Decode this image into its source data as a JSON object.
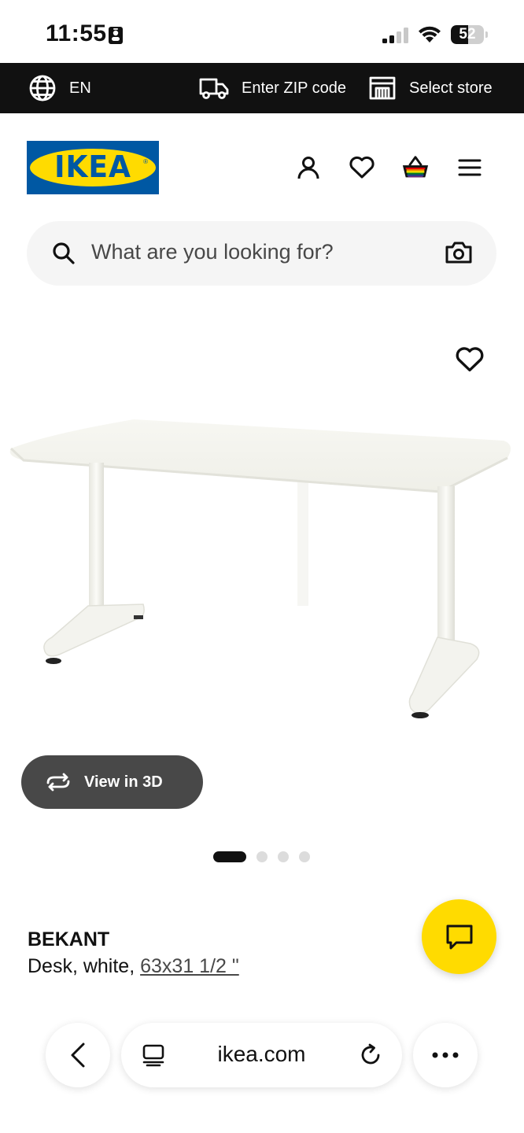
{
  "status_bar": {
    "time": "11:55",
    "battery": "52",
    "battery_level": 0.52
  },
  "top_bar": {
    "language": "EN",
    "zip": "Enter ZIP code",
    "store": "Select store"
  },
  "header": {
    "logo_text": "IKEA",
    "logo_reg": "®",
    "icons": [
      "profile-icon",
      "heart-icon",
      "cart-icon",
      "menu-icon"
    ]
  },
  "search": {
    "placeholder": "What are you looking for?"
  },
  "product": {
    "view3d": "View in 3D",
    "image_count": 4,
    "active_image": 1,
    "name": "BEKANT",
    "description": "Desk, white, ",
    "size_link": "63x31 1/2 \""
  },
  "browser": {
    "url": "ikea.com"
  },
  "colors": {
    "ikea_blue": "#0058a3",
    "ikea_yellow": "#ffdb00",
    "top_bar": "#111111",
    "view3d_bg": "#484848"
  }
}
